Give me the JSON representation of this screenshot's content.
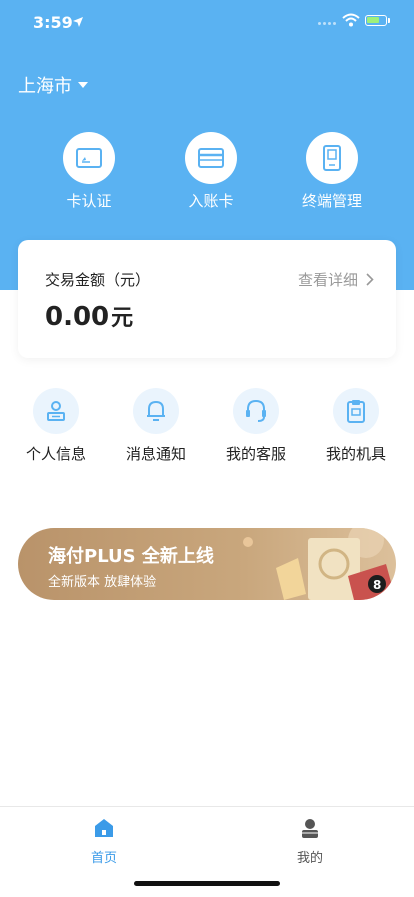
{
  "status_bar": {
    "time": "3:59"
  },
  "header": {
    "city": "上海市"
  },
  "quick_actions": [
    {
      "label": "卡认证",
      "icon": "card-verify-icon"
    },
    {
      "label": "入账卡",
      "icon": "bank-card-icon"
    },
    {
      "label": "终端管理",
      "icon": "terminal-icon"
    }
  ],
  "transaction_card": {
    "title": "交易金额（元）",
    "link": "查看详细",
    "amount": "0.00",
    "unit": "元"
  },
  "features": [
    {
      "label": "个人信息",
      "icon": "person-info-icon"
    },
    {
      "label": "消息通知",
      "icon": "bell-icon"
    },
    {
      "label": "我的客服",
      "icon": "headset-icon"
    },
    {
      "label": "我的机具",
      "icon": "clipboard-device-icon"
    }
  ],
  "banner": {
    "title": "海付PLUS 全新上线",
    "subtitle": "全新版本 放肆体验"
  },
  "tabbar": [
    {
      "label": "首页",
      "active": true,
      "icon": "home-icon"
    },
    {
      "label": "我的",
      "active": false,
      "icon": "profile-icon"
    }
  ],
  "colors": {
    "primary": "#5ab2f2",
    "tab_active": "#3b9be8",
    "tab_inactive": "#555555"
  }
}
